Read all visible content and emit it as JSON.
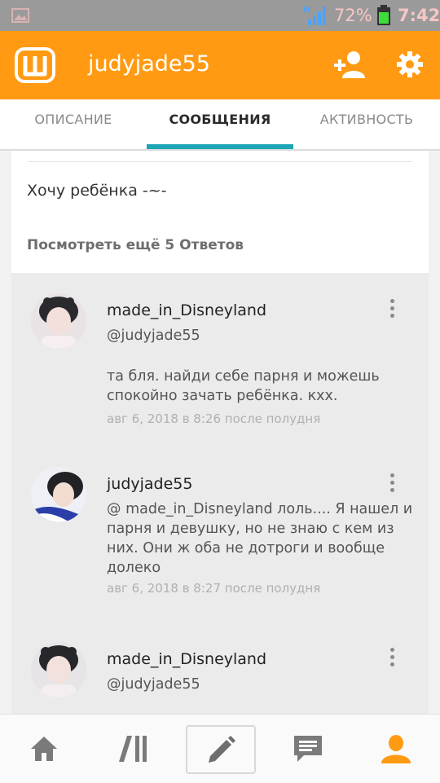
{
  "status_bar": {
    "battery_percent": "72%",
    "time": "7:42",
    "icons": [
      "gallery-icon",
      "signal-icon",
      "battery-icon"
    ]
  },
  "app_bar": {
    "title": "judyjade55",
    "logo_icon": "wattpad-logo-icon",
    "actions": [
      "add-user-icon",
      "settings-icon"
    ],
    "color": "#ff9a12"
  },
  "tabs": {
    "items": [
      {
        "label": "ОПИСАНИЕ"
      },
      {
        "label": "СООБЩЕНИЯ"
      },
      {
        "label": "АКТИВНОСТЬ"
      }
    ],
    "active_index": 1,
    "indicator_color": "#1ea6b7"
  },
  "post": {
    "text": "Хочу ребёнка -~-",
    "view_more": "Посмотреть ещё 5 Ответов"
  },
  "replies": [
    {
      "author": "made_in_Disneyland",
      "text": "@judyjade55\n\nта бля. найди себе парня и можешь спокойно зачать ребёнка. кхх.",
      "mention": "@judyjade55",
      "body": "та бля. найди себе парня и можешь спокойно зачать ребёнка. кхх.",
      "date": "авг 6, 2018 в 8:26 после полудня"
    },
    {
      "author": "judyjade55",
      "body": "@ made_in_Disneyland  лоль.... Я нашел и парня и девушку, но не знаю с кем из них. Они ж оба не дотроги и вообще долеко",
      "date": "авг 6, 2018 в 8:27 после полудня"
    },
    {
      "author": "made_in_Disneyland",
      "mention": "@judyjade55"
    }
  ],
  "bottom_nav": {
    "items": [
      "home-icon",
      "library-icon",
      "write-icon",
      "messages-icon",
      "profile-icon"
    ],
    "active_color": "#ff9a12"
  }
}
